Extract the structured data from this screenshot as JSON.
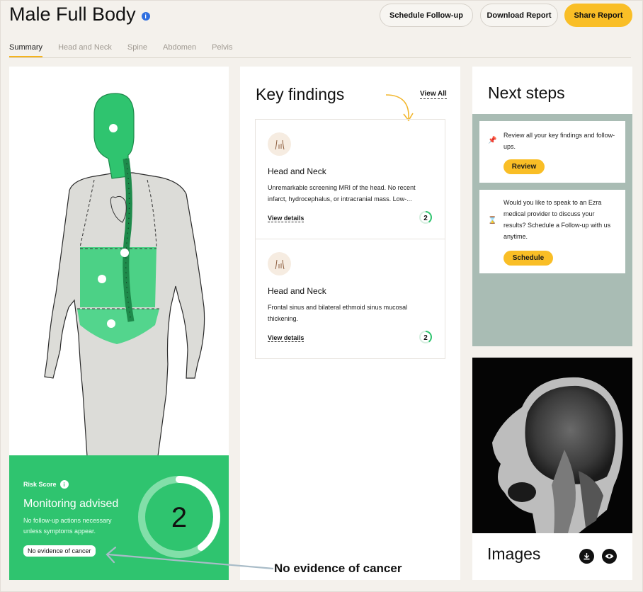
{
  "header": {
    "title": "Male Full Body",
    "info_icon": "info-icon",
    "buttons": {
      "schedule": "Schedule Follow-up",
      "download": "Download Report",
      "share": "Share Report"
    }
  },
  "tabs": [
    {
      "label": "Summary",
      "active": true
    },
    {
      "label": "Head and Neck",
      "active": false
    },
    {
      "label": "Spine",
      "active": false
    },
    {
      "label": "Abdomen",
      "active": false
    },
    {
      "label": "Pelvis",
      "active": false
    }
  ],
  "risk": {
    "label": "Risk Score",
    "title": "Monitoring advised",
    "description": "No follow-up actions necessary unless symptoms appear.",
    "badge": "No evidence of cancer",
    "score": "2",
    "ring_fill": 0.4
  },
  "key_findings": {
    "title": "Key findings",
    "view_all": "View All",
    "items": [
      {
        "heading": "Head and Neck",
        "text": "Unremarkable screening MRI of the head. No recent infarct, hydrocephalus, or intracranial mass. Low-...",
        "link": "View details",
        "score": "2"
      },
      {
        "heading": "Head and Neck",
        "text": "Frontal sinus and bilateral ethmoid sinus mucosal thickening.",
        "link": "View details",
        "score": "2"
      }
    ]
  },
  "next_steps": {
    "title": "Next steps",
    "cards": [
      {
        "text": "Review all your key findings and follow-ups.",
        "button": "Review",
        "icon": "pin-icon"
      },
      {
        "text": "Would you like to speak to an Ezra medical provider to discuss your results? Schedule a Follow-up with us anytime.",
        "button": "Schedule",
        "icon": "hourglass-icon"
      }
    ]
  },
  "images": {
    "title": "Images"
  },
  "annotation": "No evidence of cancer",
  "colors": {
    "accent": "#f9be26",
    "risk_green": "#2fc46f",
    "body_green": "#2fc46f",
    "next_steps_bg": "#a9bcb4"
  }
}
